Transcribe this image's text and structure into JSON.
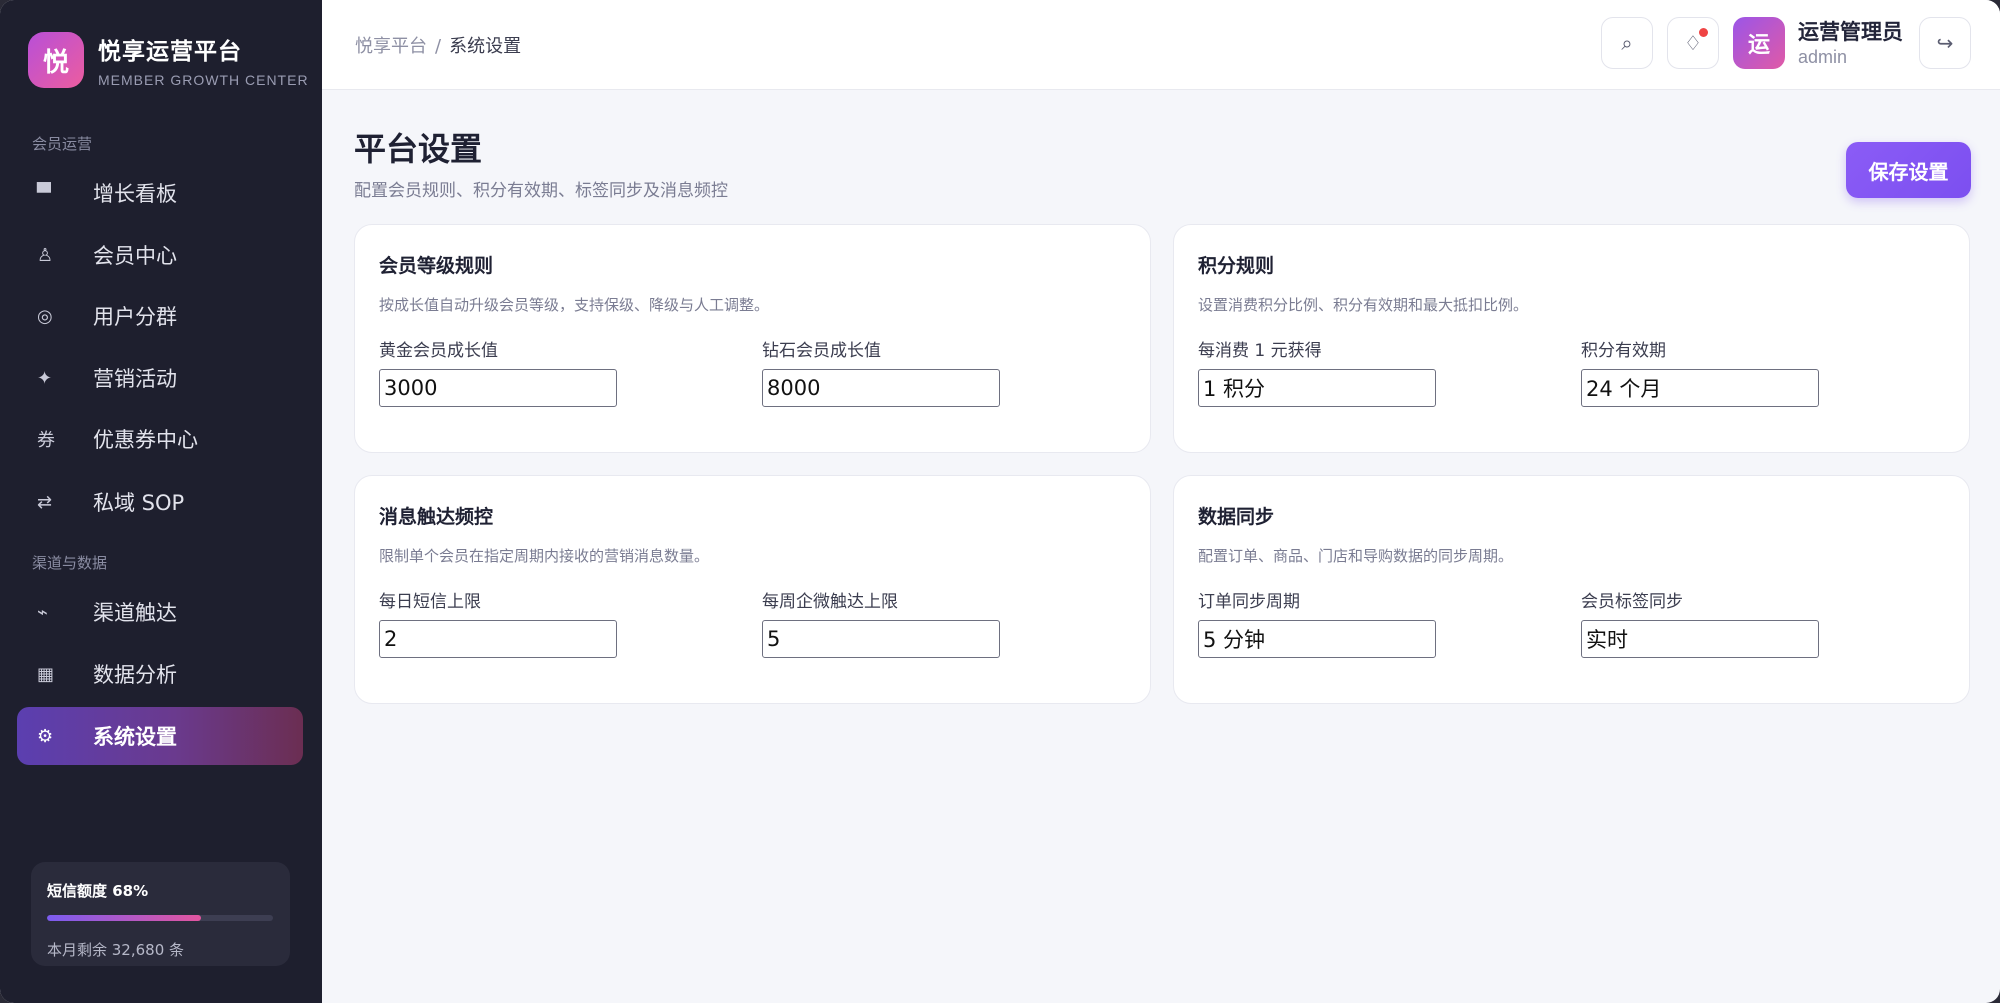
{
  "brand": {
    "logo_char": "悦",
    "title": "悦享运营平台",
    "subtitle": "MEMBER GROWTH CENTER"
  },
  "sidebar": {
    "section1": "会员运营",
    "section2": "渠道与数据",
    "items": [
      {
        "label": "增长看板",
        "icon": "dashboard-icon",
        "glyph": "▀"
      },
      {
        "label": "会员中心",
        "icon": "member-icon",
        "glyph": "♙"
      },
      {
        "label": "用户分群",
        "icon": "segment-icon",
        "glyph": "◎"
      },
      {
        "label": "营销活动",
        "icon": "sparkle-icon",
        "glyph": "✦"
      },
      {
        "label": "优惠券中心",
        "icon": "coupon-icon",
        "glyph": "券"
      },
      {
        "label": "私域 SOP",
        "icon": "swap-icon",
        "glyph": "⇄"
      },
      {
        "label": "渠道触达",
        "icon": "pulse-icon",
        "glyph": "⌁"
      },
      {
        "label": "数据分析",
        "icon": "chart-icon",
        "glyph": "▦"
      },
      {
        "label": "系统设置",
        "icon": "gear-icon",
        "glyph": "⚙"
      }
    ],
    "active_index": 8
  },
  "quota": {
    "title": "短信额度 68%",
    "percent": 68,
    "remain": "本月剩余 32,680 条"
  },
  "header": {
    "breadcrumb_root": "悦享平台",
    "breadcrumb_sep": "/",
    "breadcrumb_current": "系统设置",
    "search_glyph": "⌕",
    "notify_glyph": "♢",
    "avatar_char": "运",
    "user_name": "运营管理员",
    "user_role": "admin",
    "logout_glyph": "↪"
  },
  "page": {
    "title": "平台设置",
    "subtitle": "配置会员规则、积分有效期、标签同步及消息频控",
    "save_label": "保存设置"
  },
  "cards": [
    {
      "title": "会员等级规则",
      "desc": "按成长值自动升级会员等级，支持保级、降级与人工调整。",
      "fields": [
        {
          "label": "黄金会员成长值",
          "value": "3000"
        },
        {
          "label": "钻石会员成长值",
          "value": "8000"
        }
      ]
    },
    {
      "title": "积分规则",
      "desc": "设置消费积分比例、积分有效期和最大抵扣比例。",
      "fields": [
        {
          "label": "每消费 1 元获得",
          "value": "1 积分"
        },
        {
          "label": "积分有效期",
          "value": "24 个月"
        }
      ]
    },
    {
      "title": "消息触达频控",
      "desc": "限制单个会员在指定周期内接收的营销消息数量。",
      "fields": [
        {
          "label": "每日短信上限",
          "value": "2"
        },
        {
          "label": "每周企微触达上限",
          "value": "5"
        }
      ]
    },
    {
      "title": "数据同步",
      "desc": "配置订单、商品、门店和导购数据的同步周期。",
      "fields": [
        {
          "label": "订单同步周期",
          "value": "5 分钟"
        },
        {
          "label": "会员标签同步",
          "value": "实时"
        }
      ]
    }
  ],
  "colors": {
    "sidebar_bg": "#1e1f2e",
    "accent": "#8b5cf6",
    "notify_dot": "#ef4444"
  }
}
